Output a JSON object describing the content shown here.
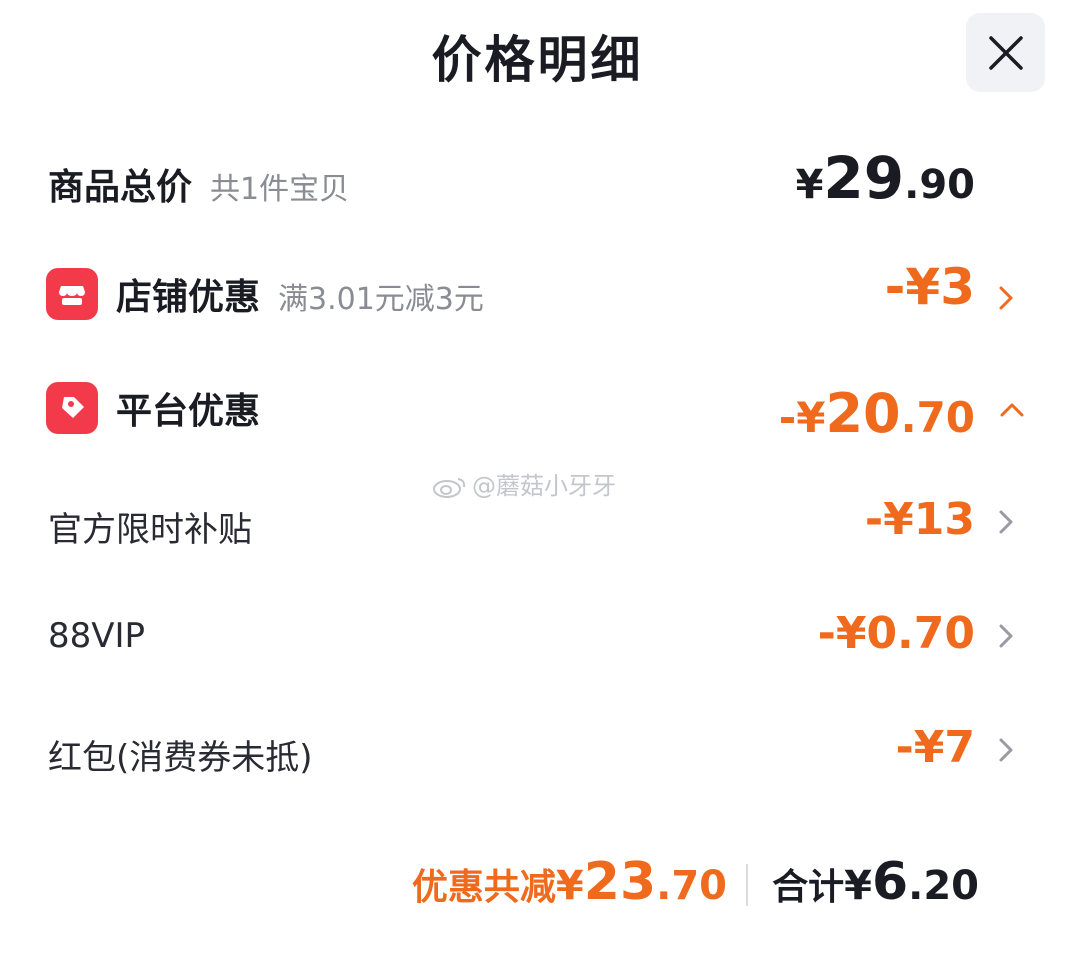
{
  "header": {
    "title": "价格明细",
    "close_icon": "close-icon"
  },
  "total_row": {
    "label": "商品总价",
    "note": "共1件宝贝",
    "yen": "¥",
    "int": "29",
    "dec": ".90"
  },
  "shop_discount": {
    "icon": "shop-icon",
    "label": "店铺优惠",
    "note": "满3.01元减3元",
    "amount": "-¥3",
    "chevron": "chevron-right-icon"
  },
  "platform_discount": {
    "icon": "tag-icon",
    "label": "平台优惠",
    "prefix": "-¥",
    "int": "20",
    "dec": ".70",
    "chevron": "chevron-up-icon"
  },
  "platform_items": [
    {
      "label": "官方限时补贴",
      "amount": "-¥13"
    },
    {
      "label": "88VIP",
      "amount": "-¥0.70"
    },
    {
      "label": "红包(消费券未抵)",
      "amount": "-¥7"
    }
  ],
  "footer": {
    "save_label": "优惠共减",
    "save_yen": "¥",
    "save_int": "23",
    "save_dec": ".70",
    "total_label": "合计",
    "total_yen": "¥",
    "total_int": "6",
    "total_dec": ".20"
  },
  "watermark": {
    "text": "@蘑菇小牙牙",
    "icon": "weibo-icon"
  },
  "colors": {
    "accent": "#ef6a1c",
    "icon_red": "#f23a4a",
    "text": "#1b1b24",
    "muted": "#8a8c93"
  }
}
